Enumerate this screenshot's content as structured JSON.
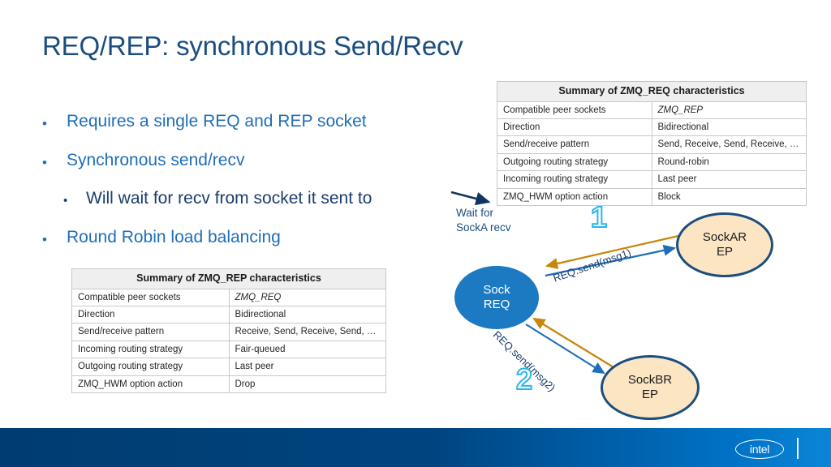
{
  "slide": {
    "title": "REQ/REP: synchronous Send/Recv"
  },
  "bullets": [
    {
      "level": 1,
      "marker": "•",
      "text": "Requires a single REQ and REP socket"
    },
    {
      "level": 1,
      "marker": "•",
      "text": "Synchronous send/recv"
    },
    {
      "level": 2,
      "marker": "•",
      "text": "Will wait for recv from socket it sent to"
    },
    {
      "level": 1,
      "marker": "•",
      "text": "Round Robin load balancing"
    }
  ],
  "table_req": {
    "title": "Summary of ZMQ_REQ characteristics",
    "rows": [
      {
        "key": "Compatible peer sockets",
        "value": "ZMQ_REP",
        "italic": true
      },
      {
        "key": "Direction",
        "value": "Bidirectional",
        "italic": false
      },
      {
        "key": "Send/receive pattern",
        "value": "Send, Receive, Send, Receive, …",
        "italic": false
      },
      {
        "key": "Outgoing routing strategy",
        "value": "Round-robin",
        "italic": false
      },
      {
        "key": "Incoming routing strategy",
        "value": "Last peer",
        "italic": false
      },
      {
        "key": "ZMQ_HWM option action",
        "value": "Block",
        "italic": false
      }
    ]
  },
  "table_rep": {
    "title": "Summary of ZMQ_REP characteristics",
    "rows": [
      {
        "key": "Compatible peer sockets",
        "value": "ZMQ_REQ",
        "italic": true
      },
      {
        "key": "Direction",
        "value": "Bidirectional",
        "italic": false
      },
      {
        "key": "Send/receive pattern",
        "value": "Receive, Send, Receive, Send, …",
        "italic": false
      },
      {
        "key": "Incoming routing strategy",
        "value": "Fair-queued",
        "italic": false
      },
      {
        "key": "Outgoing routing strategy",
        "value": "Last peer",
        "italic": false
      },
      {
        "key": "ZMQ_HWM option action",
        "value": "Drop",
        "italic": false
      }
    ]
  },
  "diagram": {
    "wait_label": "Wait for\nSockA recv",
    "nodes": {
      "req": {
        "line1": "Sock",
        "line2": "REQ",
        "fill": "#1c7ac2",
        "text_color": "#ffffff"
      },
      "sock_a": {
        "line1": "SockAR",
        "line2": "EP",
        "fill": "#fbe5c3",
        "border": "#1b4d7e"
      },
      "sock_b": {
        "line1": "SockBR",
        "line2": "EP",
        "fill": "#fbe5c3",
        "border": "#1b4d7e"
      }
    },
    "arrow_labels": {
      "msg1": "REQ.send(msg1)",
      "msg2": "REQ.send(msg2)"
    },
    "step_numbers": {
      "one": "1",
      "two": "2"
    },
    "colors": {
      "send_arrow": "#1f6eb8",
      "reply_arrow": "#c8860d",
      "pointer_arrow": "#12355f",
      "step_number_outline": "#29b6e8"
    }
  },
  "footer": {
    "logo_text": "intel"
  }
}
